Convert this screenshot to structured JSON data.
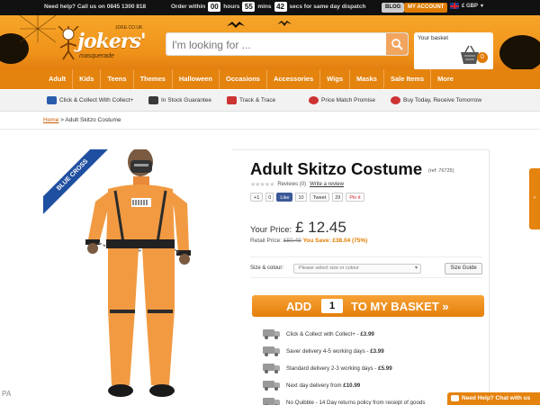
{
  "topbar": {
    "help": "Need help? Call us on 0845 1300 818",
    "order_within": "Order within",
    "hours_value": "00",
    "hours_label": "hours",
    "mins_value": "55",
    "mins_label": "mins",
    "secs_value": "42",
    "secs_label": "secs for same day dispatch",
    "blog": "BLOG",
    "account": "MY ACCOUNT",
    "currency": "£ GBP"
  },
  "header": {
    "logo_name": "jokers'",
    "logo_sub": "masquerade",
    "logo_url": "JOKE.CO.UK",
    "search_placeholder": "I'm looking for ...",
    "basket_label": "Your basket",
    "basket_count": "0"
  },
  "nav": [
    "Adult",
    "Kids",
    "Teens",
    "Themes",
    "Halloween",
    "Occasions",
    "Accessories",
    "Wigs",
    "Masks",
    "Sale Items",
    "More"
  ],
  "usp": [
    "Click & Collect With Collect+",
    "In Stock Guarantee",
    "Track & Trace",
    "Price Match Promise",
    "Buy Today, Receive Tomorrow"
  ],
  "breadcrumb": {
    "home": "Home",
    "sep": ">",
    "current": "Adult Skitzo Costume"
  },
  "product": {
    "ribbon": "BLUE CROSS",
    "title": "Adult Skitzo Costume",
    "ref": "(ref: 76725)",
    "reviews": "Reviews (0)",
    "write_review": "Write a review",
    "social": {
      "gplus": "+1",
      "gplus_count": "0",
      "fb": "Like",
      "fb_count": "10",
      "tweet": "Tweet",
      "tweet_count": "29",
      "pin": "Pin it"
    },
    "your_price_label": "Your Price:",
    "price": "£ 12.45",
    "retail_label": "Retail Price:",
    "retail_price": "£50.49",
    "you_save": "You Save: £38.04 (75%)",
    "size_label": "Size & colour:",
    "size_placeholder": "Please select size or colour",
    "size_guide": "Size Guide",
    "add_label": "ADD",
    "qty": "1",
    "to_basket": "TO MY BASKET »",
    "stars": "★★★★★"
  },
  "delivery": [
    {
      "text": "Click & Collect with Collect+ - ",
      "price": "£3.99"
    },
    {
      "text": "Saver delivery 4-5 working days - ",
      "price": "£3.99"
    },
    {
      "text": "Standard delivery 2-3 working days - ",
      "price": "£5.99"
    },
    {
      "text": "Next day delivery from ",
      "price": "£10.99"
    },
    {
      "text": "No Quibble - 14 Day returns policy from receipt of goods",
      "price": ""
    }
  ],
  "chat": "Need Help? Chat with us",
  "watermark": "PA",
  "colors": {
    "brand_orange": "#e5830f",
    "ribbon_blue": "#1f4fa0",
    "topbar": "#111111"
  }
}
